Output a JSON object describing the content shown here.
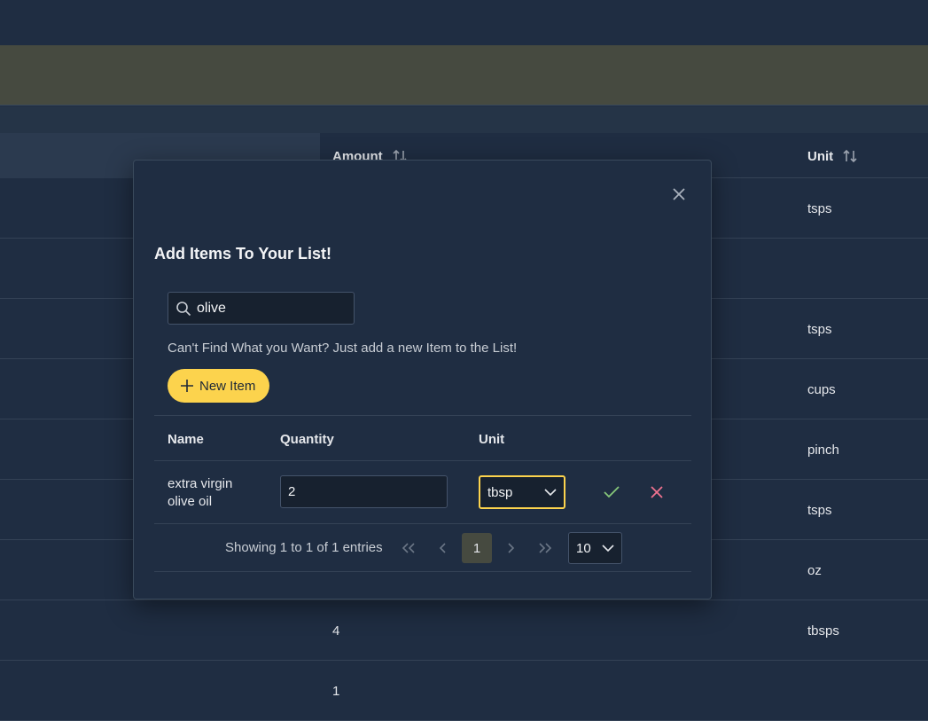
{
  "background": {
    "headers": {
      "amount": "Amount",
      "unit": "Unit"
    },
    "rows": [
      {
        "amount": "",
        "unit": "tsps"
      },
      {
        "amount": "",
        "unit": ""
      },
      {
        "amount": "",
        "unit": "tsps"
      },
      {
        "amount": "",
        "unit": "cups"
      },
      {
        "amount": "",
        "unit": "pinch"
      },
      {
        "amount": "",
        "unit": "tsps"
      },
      {
        "amount": "",
        "unit": "oz"
      },
      {
        "amount": "4",
        "unit": "tbsps"
      },
      {
        "amount": "1",
        "unit": ""
      }
    ]
  },
  "modal": {
    "title": "Add Items To Your List!",
    "search_value": "olive",
    "hint": "Can't Find What you Want? Just add a new Item to the List!",
    "new_item_label": "New Item",
    "table": {
      "headers": {
        "name": "Name",
        "quantity": "Quantity",
        "unit": "Unit"
      },
      "rows": [
        {
          "name": "extra virgin olive oil",
          "quantity": "2",
          "unit": "tbsp"
        }
      ]
    },
    "pagination": {
      "info": "Showing 1 to 1 of 1 entries",
      "current_page": "1",
      "per_page": "10"
    }
  },
  "colors": {
    "accent": "#fcd34d",
    "confirm": "#86c77a",
    "cancel": "#f0728f",
    "background": "#1f2d42"
  }
}
